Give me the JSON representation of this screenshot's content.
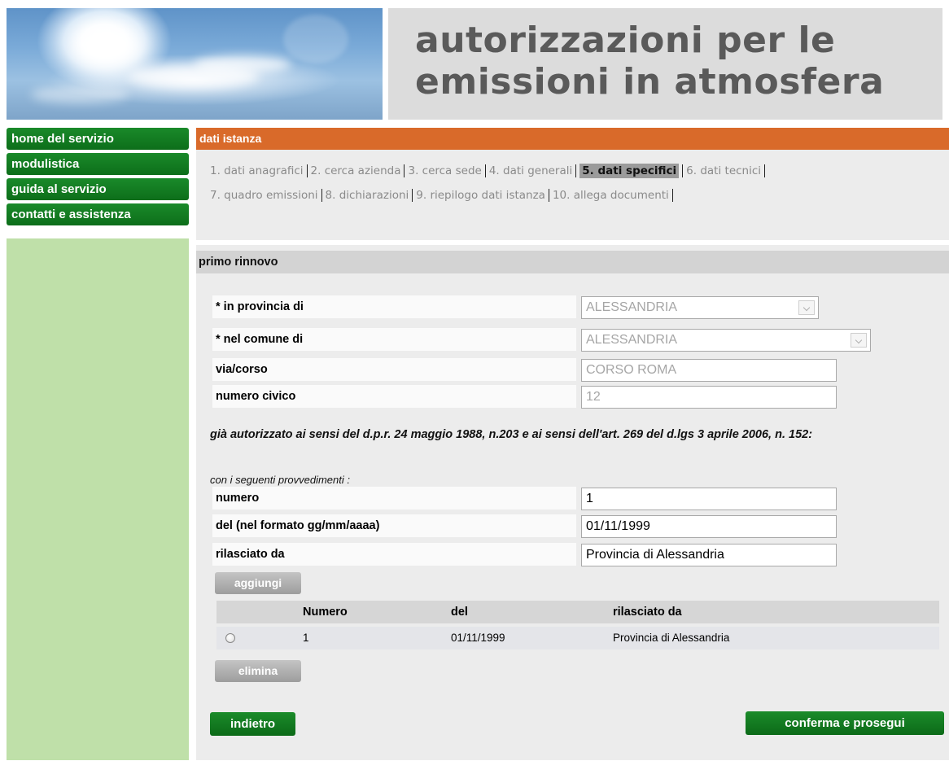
{
  "header": {
    "title_line1": "autorizzazioni per le",
    "title_line2": "emissioni in atmosfera"
  },
  "sidebar": {
    "items": [
      {
        "label": "home del servizio"
      },
      {
        "label": "modulistica"
      },
      {
        "label": "guida al servizio"
      },
      {
        "label": "contatti e assistenza"
      }
    ]
  },
  "main": {
    "section_title": "dati istanza",
    "steps": [
      {
        "label": "1. dati anagrafici"
      },
      {
        "label": "2. cerca azienda"
      },
      {
        "label": "3. cerca sede"
      },
      {
        "label": "4. dati generali"
      },
      {
        "label": "5. dati specifici",
        "active": true
      },
      {
        "label": "6. dati tecnici"
      },
      {
        "label": "7. quadro emissioni"
      },
      {
        "label": "8. dichiarazioni"
      },
      {
        "label": "9. riepilogo dati istanza"
      },
      {
        "label": "10. allega documenti"
      }
    ],
    "subsection_title": "primo rinnovo",
    "form": {
      "provincia": {
        "label": "* in provincia di",
        "value": "ALESSANDRIA"
      },
      "comune": {
        "label": "* nel comune di",
        "value": "ALESSANDRIA"
      },
      "via": {
        "label": "via/corso",
        "value": "CORSO ROMA"
      },
      "civico": {
        "label": "numero civico",
        "value": "12"
      }
    },
    "note": "già autorizzato ai sensi del d.p.r. 24 maggio 1988, n.203 e ai sensi dell'art. 269 del d.lgs 3 aprile 2006, n. 152:",
    "note_sub": "con i seguenti provvedimenti :",
    "prov_form": {
      "numero": {
        "label": "numero",
        "value": "1"
      },
      "del": {
        "label": "del (nel formato gg/mm/aaaa)",
        "value": "01/11/1999"
      },
      "rilasciato": {
        "label": "rilasciato da",
        "value": "Provincia di Alessandria"
      }
    },
    "add_button": "aggiungi",
    "table": {
      "columns": [
        "Numero",
        "del",
        "rilasciato da"
      ],
      "rows": [
        {
          "numero": "1",
          "del": "01/11/1999",
          "rilasciato": "Provincia di Alessandria"
        }
      ]
    },
    "delete_button": "elimina",
    "back_button": "indietro",
    "confirm_button": "conferma e prosegui"
  },
  "colors": {
    "accent_orange": "#d96a2a",
    "nav_green": "#0d6e1a",
    "sidebar_fill": "#bfe0a9",
    "panel_gray": "#ececec"
  }
}
